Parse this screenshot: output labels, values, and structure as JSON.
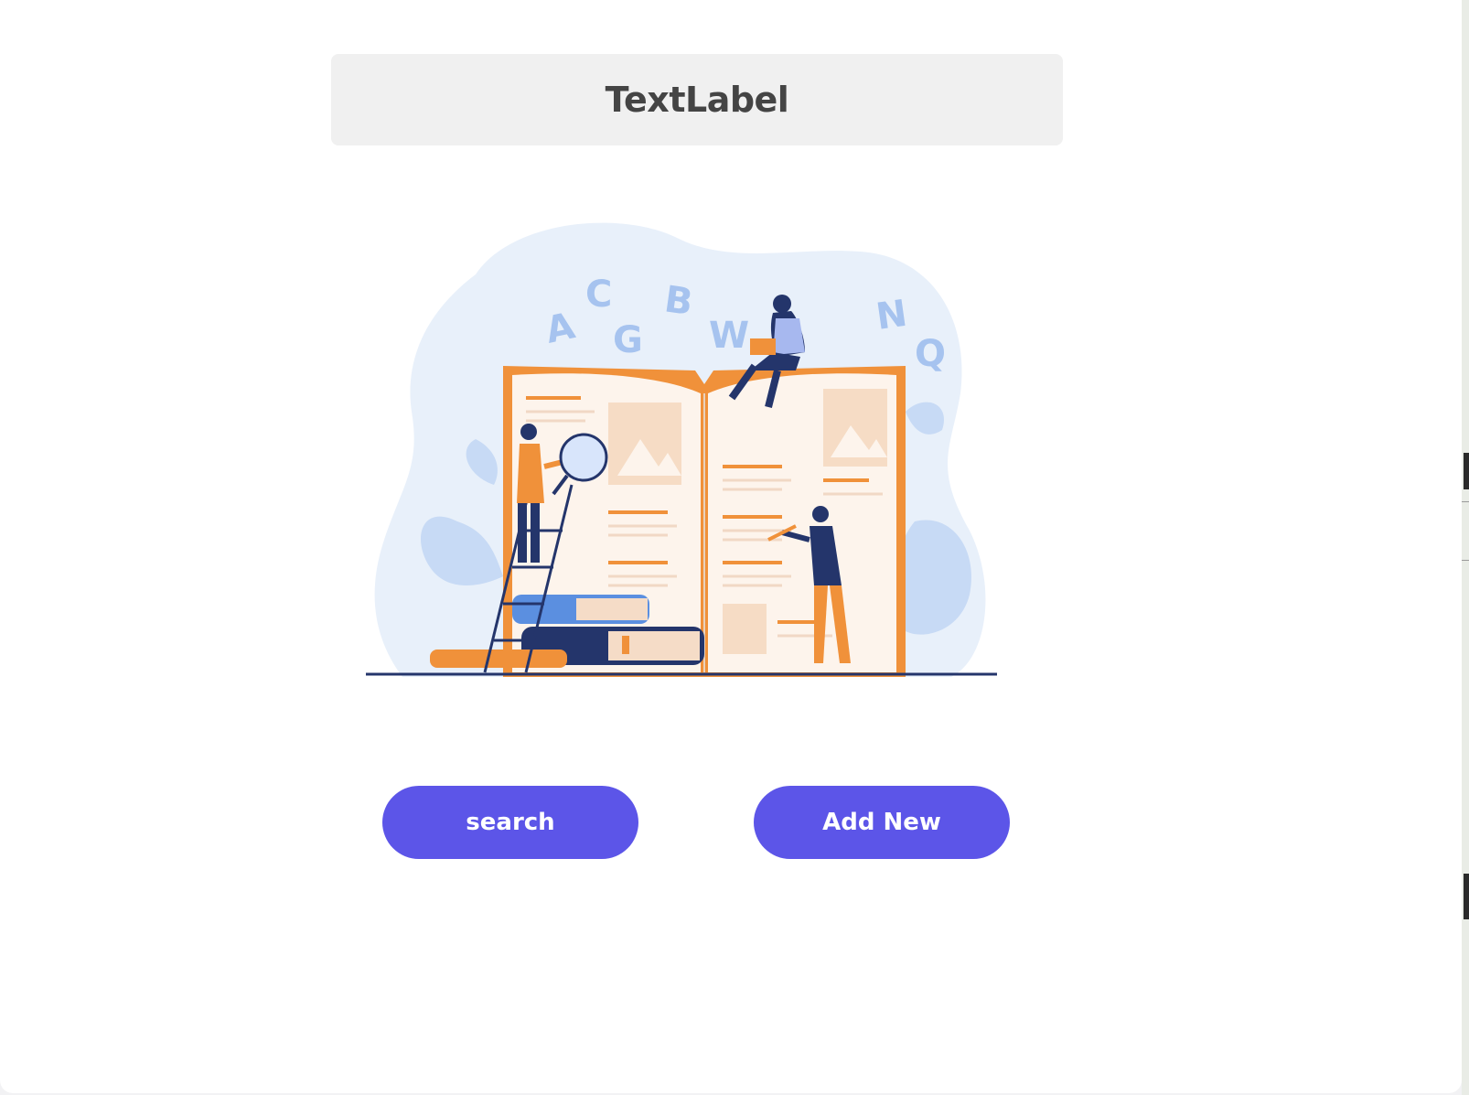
{
  "header": {
    "title": "TextLabel"
  },
  "illustration": {
    "letters": [
      "A",
      "C",
      "G",
      "B",
      "W",
      "N",
      "Q"
    ]
  },
  "actions": {
    "search_label": "search",
    "add_new_label": "Add New"
  },
  "colors": {
    "button_bg": "#5c55e8",
    "button_text": "#ffffff",
    "title_bg": "#f0f0f0",
    "title_text": "#444444",
    "accent_orange": "#f0913a",
    "accent_navy": "#24356b",
    "blob_blue": "#e8f0fa"
  }
}
